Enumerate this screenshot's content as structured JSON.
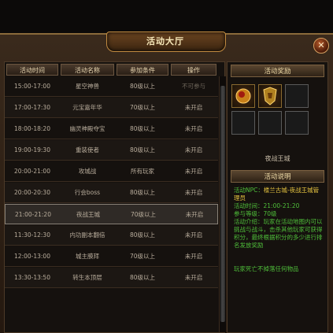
{
  "window": {
    "title": "活动大厅",
    "close_label": "✕"
  },
  "table": {
    "headers": [
      "活动时间",
      "活动名称",
      "参加条件",
      "操作"
    ],
    "rows": [
      {
        "time": "15:00-17:00",
        "name": "星空神兽",
        "cond": "80级以上",
        "action": "不可参与"
      },
      {
        "time": "17:00-17:30",
        "name": "元宝嘉年华",
        "cond": "70级以上",
        "action": "未开启"
      },
      {
        "time": "18:00-18:20",
        "name": "幽灵神殿夺宝",
        "cond": "80级以上",
        "action": "未开启"
      },
      {
        "time": "19:00-19:30",
        "name": "重装使者",
        "cond": "80级以上",
        "action": "未开启"
      },
      {
        "time": "20:00-21:00",
        "name": "攻城战",
        "cond": "所有玩家",
        "action": "未开启"
      },
      {
        "time": "20:00-20:30",
        "name": "行会boss",
        "cond": "80级以上",
        "action": "未开启"
      },
      {
        "time": "21:00-21:20",
        "name": "夜战王城",
        "cond": "70级以上",
        "action": "未开启"
      },
      {
        "time": "11:30-12:30",
        "name": "内功副本翻倍",
        "cond": "80级以上",
        "action": "未开启"
      },
      {
        "time": "12:00-13:00",
        "name": "城主膜拜",
        "cond": "70级以上",
        "action": "未开启"
      },
      {
        "time": "13:30-13:50",
        "name": "转生本顶层",
        "cond": "80级以上",
        "action": "未开启"
      }
    ]
  },
  "reward": {
    "heading": "活动奖励",
    "item_name": "夜战王城"
  },
  "info": {
    "heading": "活动说明",
    "npc_label": "活动NPC：",
    "npc_value": "楼兰古城-夜战王城管理员",
    "time_label": "活动时间：",
    "time_value": "21:00-21:20",
    "level_label": "参与等级：",
    "level_value": "70级",
    "intro_label": "活动介绍：",
    "intro_text": "玩家在活动地图内可以挑战与战斗，击杀其他玩家可获得积分，最终根据积分的多少进行排名发放奖励",
    "note": "玩家死亡不掉落任何物品"
  }
}
